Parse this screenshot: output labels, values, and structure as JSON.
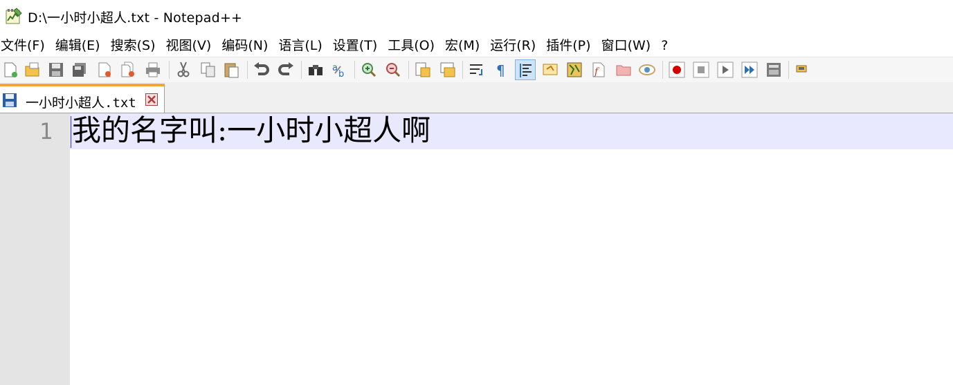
{
  "window": {
    "title": "D:\\一小时小超人.txt - Notepad++",
    "icon": "notepadpp-app-icon"
  },
  "menu": {
    "items": [
      {
        "label": "文件(F)"
      },
      {
        "label": "编辑(E)"
      },
      {
        "label": "搜索(S)"
      },
      {
        "label": "视图(V)"
      },
      {
        "label": "编码(N)"
      },
      {
        "label": "语言(L)"
      },
      {
        "label": "设置(T)"
      },
      {
        "label": "工具(O)"
      },
      {
        "label": "宏(M)"
      },
      {
        "label": "运行(R)"
      },
      {
        "label": "插件(P)"
      },
      {
        "label": "窗口(W)"
      },
      {
        "label": "?"
      }
    ]
  },
  "toolbar": {
    "icons": [
      "new-file-icon",
      "open-file-icon",
      "save-icon",
      "save-all-icon",
      "close-icon",
      "close-all-icon",
      "print-icon",
      "cut-icon",
      "copy-icon",
      "paste-icon",
      "undo-icon",
      "redo-icon",
      "find-icon",
      "replace-icon",
      "zoom-in-icon",
      "zoom-out-icon",
      "sync-vertical-icon",
      "sync-horizontal-icon",
      "word-wrap-icon",
      "show-all-chars-icon",
      "indent-guide-icon",
      "user-language-icon",
      "document-map-icon",
      "function-list-icon",
      "folder-workspace-icon",
      "monitoring-icon",
      "record-macro-icon",
      "stop-record-icon",
      "play-macro-icon",
      "run-macro-multiple-icon",
      "save-macro-icon",
      "plugin-icon"
    ]
  },
  "tabs": [
    {
      "label": "一小时小超人.txt",
      "close_icon": "tab-close-icon",
      "state_icon": "saved-document-icon"
    }
  ],
  "editor": {
    "lines": [
      {
        "number": "1",
        "text": "我的名字叫:一小时小超人啊"
      }
    ],
    "current_line_color": "#e8e8ff",
    "gutter_color": "#e4e4e4"
  },
  "colors": {
    "tab_accent": "#f5a33a",
    "toolbar_bg": "#f6f6f6"
  }
}
